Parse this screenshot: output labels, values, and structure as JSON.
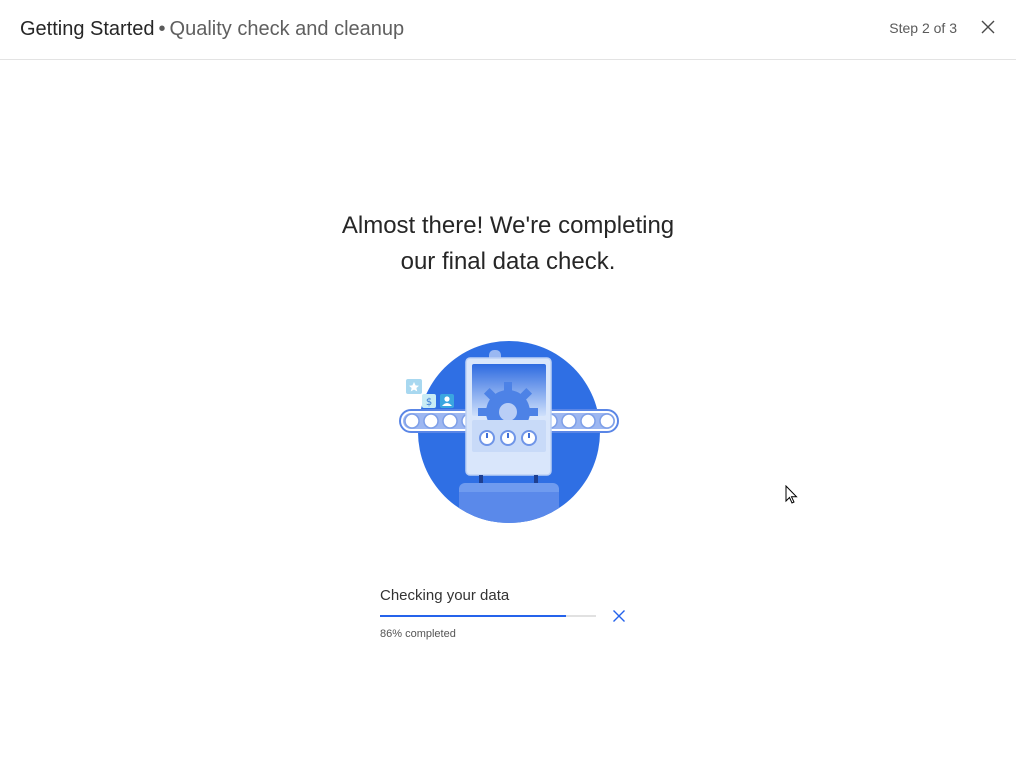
{
  "header": {
    "title": "Getting Started",
    "separator": "•",
    "subtitle": "Quality check and cleanup",
    "step": "Step 2 of 3",
    "close_icon": "close-icon"
  },
  "main": {
    "headline_line1": "Almost there! We're completing",
    "headline_line2": "our final data check.",
    "illustration_icon": "data-check-machine-illustration"
  },
  "progress": {
    "label": "Checking your data",
    "percent": 86,
    "caption": "86% completed",
    "cancel_icon": "close-icon"
  },
  "colors": {
    "accent": "#2563eb",
    "illustration_blue": "#2f6fe4",
    "track": "#e1e1e1"
  }
}
